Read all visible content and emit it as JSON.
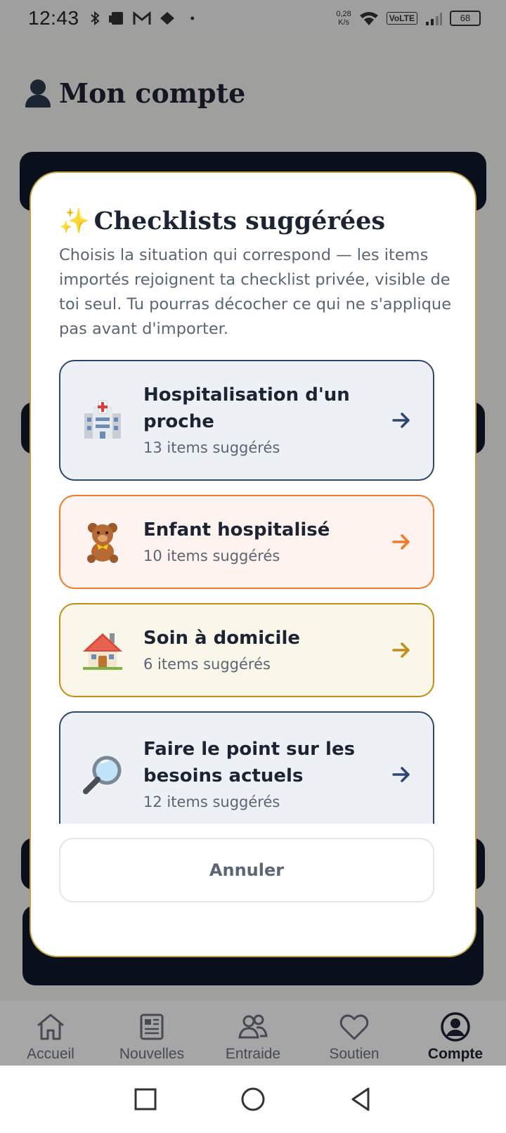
{
  "status_bar": {
    "time": "12:43",
    "speed_value": "0,28",
    "speed_unit": "K/s",
    "volte": "VoLTE",
    "battery": "68"
  },
  "page": {
    "title": "Mon compte"
  },
  "modal": {
    "title": "Checklists suggérées",
    "description": "Choisis la situation qui correspond — les items importés rejoignent ta checklist privée, visible de toi seul. Tu pourras décocher ce qui ne s'applique pas avant d'importer.",
    "options": [
      {
        "name": "Hospitalisation d'un proche",
        "count": "13 items suggérés",
        "icon": "hospital-icon",
        "border": "#2f4670",
        "bg": "#edf0f5",
        "arrow": "#2f4670"
      },
      {
        "name": "Enfant hospitalisé",
        "count": "10 items suggérés",
        "icon": "teddy-bear-icon",
        "border": "#ef7a2a",
        "bg": "#fef3ee",
        "arrow": "#ef7a2a"
      },
      {
        "name": "Soin à domicile",
        "count": "6 items suggérés",
        "icon": "house-icon",
        "border": "#c08e16",
        "bg": "#faf6ea",
        "arrow": "#c08e16"
      },
      {
        "name": "Faire le point sur les besoins actuels",
        "count": "12 items suggérés",
        "icon": "magnifier-icon",
        "border": "#2f4670",
        "bg": "#edf0f5",
        "arrow": "#2f4670"
      }
    ],
    "cancel_label": "Annuler"
  },
  "bottom_nav": {
    "items": [
      {
        "label": "Accueil",
        "icon": "home-icon"
      },
      {
        "label": "Nouvelles",
        "icon": "newspaper-icon"
      },
      {
        "label": "Entraide",
        "icon": "people-icon"
      },
      {
        "label": "Soutien",
        "icon": "heart-icon"
      },
      {
        "label": "Compte",
        "icon": "account-icon",
        "active": true
      }
    ]
  },
  "system_nav": {
    "icons": [
      "recents-icon",
      "home-circle-icon",
      "back-icon"
    ]
  }
}
